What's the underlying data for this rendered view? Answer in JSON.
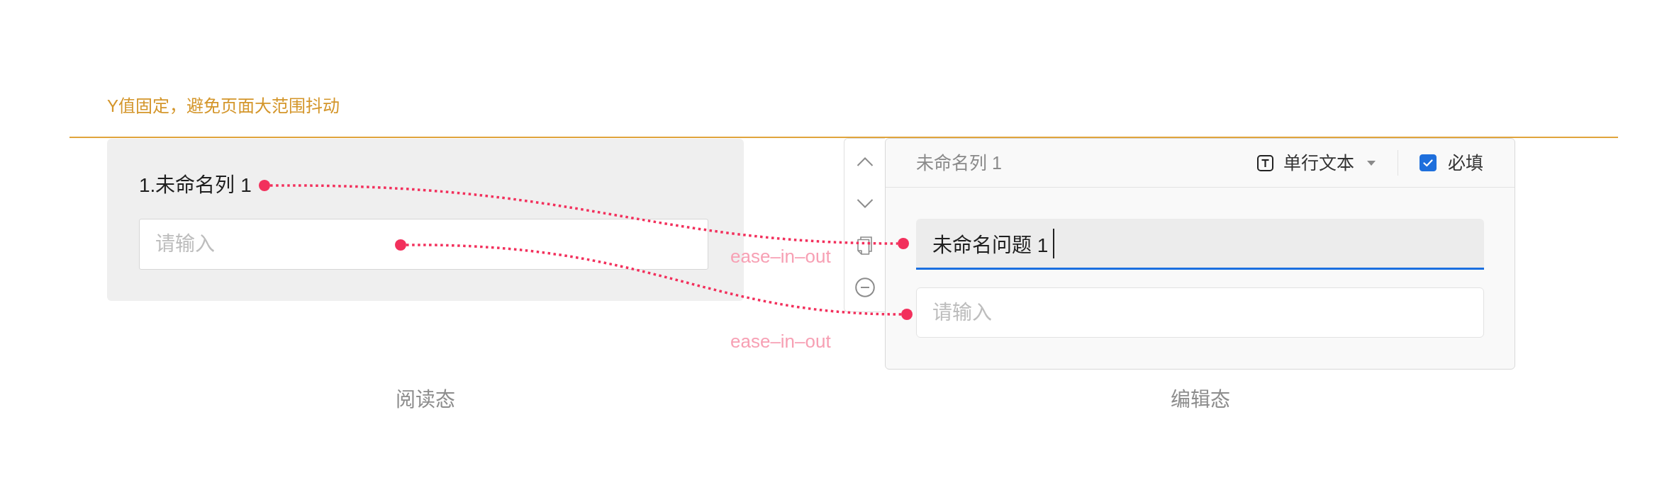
{
  "note": {
    "text": "Y值固定，避免页面大范围抖动"
  },
  "read_state": {
    "label": "1.未命名列 1",
    "input": {
      "placeholder": "请输入"
    },
    "caption": "阅读态"
  },
  "transitions": [
    {
      "label": "ease–in–out"
    },
    {
      "label": "ease–in–out"
    }
  ],
  "edit_state": {
    "header": {
      "title": "未命名列 1",
      "type_select": {
        "value": "单行文本"
      },
      "required": {
        "label": "必填",
        "checked": true
      }
    },
    "title_input": {
      "value": "未命名问题 1",
      "focused": true
    },
    "description_input": {
      "placeholder": "请输入"
    },
    "caption": "编辑态"
  }
}
